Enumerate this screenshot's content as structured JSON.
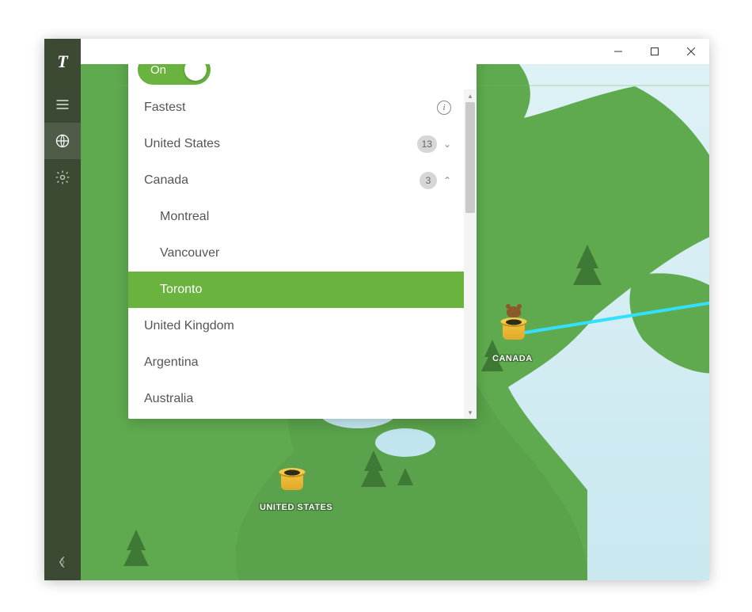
{
  "app": {
    "logo": "T"
  },
  "toggle": {
    "label": "On",
    "state": true
  },
  "locations": {
    "fastest": "Fastest",
    "items": [
      {
        "name": "United States",
        "count": 13,
        "expanded": false
      },
      {
        "name": "Canada",
        "count": 3,
        "expanded": true,
        "children": [
          "Montreal",
          "Vancouver",
          "Toronto"
        ],
        "selected_child": "Toronto"
      },
      {
        "name": "United Kingdom"
      },
      {
        "name": "Argentina"
      },
      {
        "name": "Australia"
      }
    ]
  },
  "map": {
    "labels": {
      "canada": "CANADA",
      "us": "UNITED STATES"
    }
  }
}
